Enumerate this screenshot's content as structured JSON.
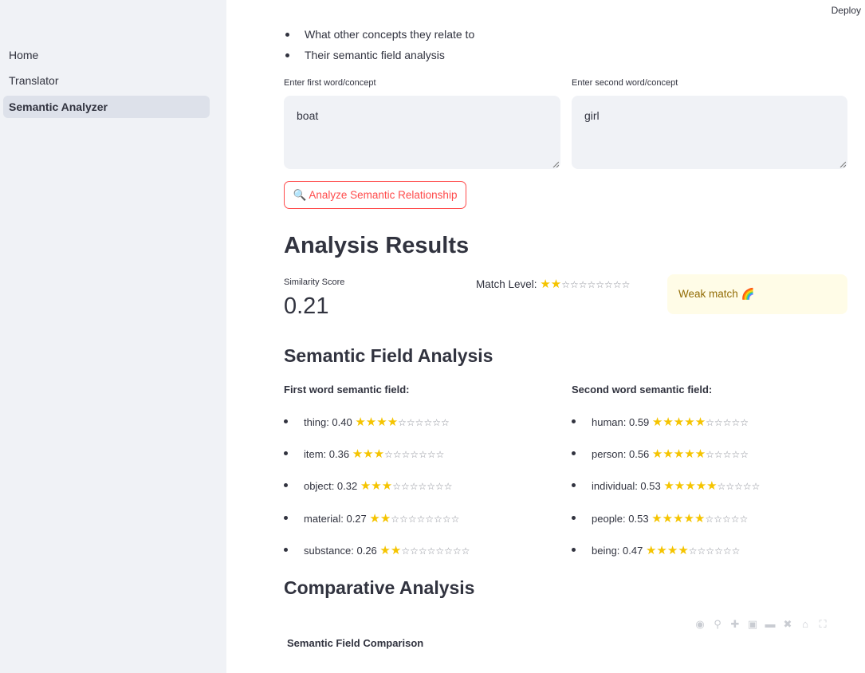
{
  "sidebar": {
    "items": [
      {
        "label": "Home"
      },
      {
        "label": "Translator"
      },
      {
        "label": "Semantic Analyzer"
      }
    ]
  },
  "header": {
    "deploy_label": "Deploy"
  },
  "intro_bullets": [
    "What other concepts they relate to",
    "Their semantic field analysis"
  ],
  "inputs": {
    "first_label": "Enter first word/concept",
    "first_value": "boat",
    "second_label": "Enter second word/concept",
    "second_value": "girl"
  },
  "analyze_button": {
    "icon": "magnifier-icon",
    "label": "🔍 Analyze Semantic Relationship"
  },
  "results": {
    "title": "Analysis Results",
    "similarity_label": "Similarity Score",
    "similarity_value": "0.21",
    "match_level_label": "Match Level:",
    "match_level_stars": 2,
    "match_level_total": 10,
    "weak_match_text": "Weak match 🌈",
    "weak_match_color": "#926c05"
  },
  "semantic_field": {
    "title": "Semantic Field Analysis",
    "first_heading": "First word semantic field:",
    "second_heading": "Second word semantic field:",
    "first_items": [
      {
        "label": "thing: 0.40",
        "stars": 4
      },
      {
        "label": "item: 0.36",
        "stars": 3
      },
      {
        "label": "object: 0.32",
        "stars": 3
      },
      {
        "label": "material: 0.27",
        "stars": 2
      },
      {
        "label": "substance: 0.26",
        "stars": 2
      }
    ],
    "second_items": [
      {
        "label": "human: 0.59",
        "stars": 5
      },
      {
        "label": "person: 0.56",
        "stars": 5
      },
      {
        "label": "individual: 0.53",
        "stars": 5
      },
      {
        "label": "people: 0.53",
        "stars": 5
      },
      {
        "label": "being: 0.47",
        "stars": 4
      }
    ],
    "total_stars": 10
  },
  "comparative": {
    "title": "Comparative Analysis",
    "chart_title": "Semantic Field Comparison",
    "toolbar_icons": [
      "camera-icon",
      "zoom-icon",
      "pan-icon",
      "zoom-in-icon",
      "zoom-out-icon",
      "autoscale-icon",
      "home-icon",
      "fullscreen-icon"
    ]
  },
  "colors": {
    "accent": "#ff4b4b",
    "sidebar_bg": "#f0f2f6",
    "star": "#f5c400"
  }
}
